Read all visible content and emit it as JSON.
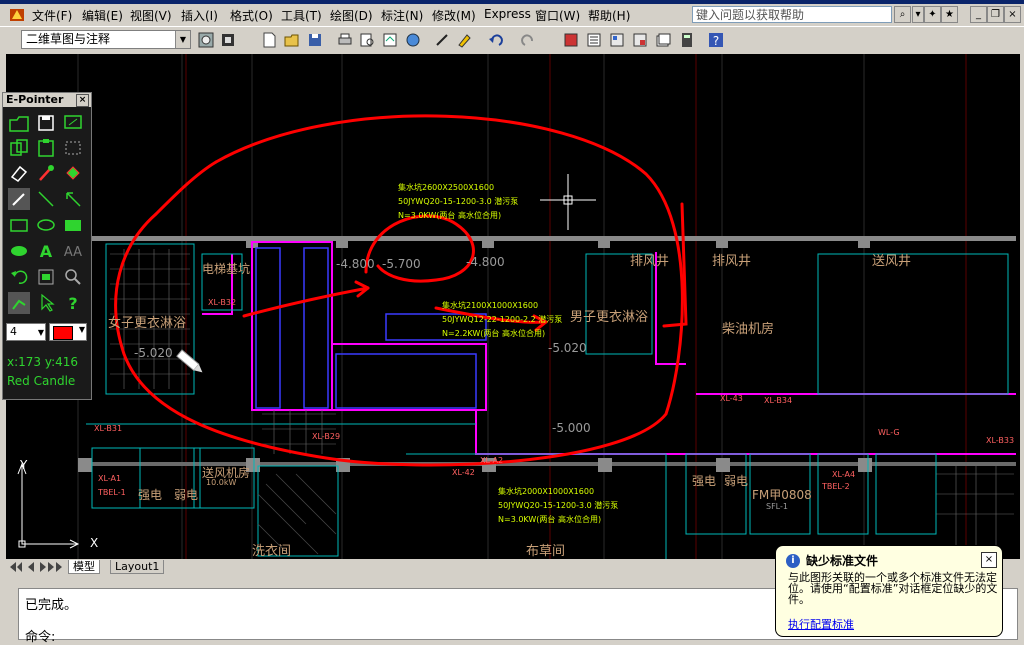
{
  "menubar": {
    "items": [
      "文件(F)",
      "编辑(E)",
      "视图(V)",
      "插入(I)",
      "格式(O)",
      "工具(T)",
      "绘图(D)",
      "标注(N)",
      "修改(M)",
      "Express",
      "窗口(W)",
      "帮助(H)"
    ],
    "search_placeholder": "键入问题以获取帮助"
  },
  "toolbar": {
    "workspace": "二维草图与注释"
  },
  "canvas": {
    "rooms": [
      "电梯基坑",
      "女子更衣淋浴",
      "排风井",
      "排风井",
      "送风井",
      "男子更衣淋浴",
      "柴油机房",
      "送风机房",
      "洗衣间",
      "布草间",
      "强电",
      "弱电",
      "强电",
      "弱电",
      "FM甲0808"
    ],
    "levels": [
      "-4.800",
      "-5.700",
      "-4.800",
      "-5.020",
      "-5.020",
      "-5.000"
    ],
    "notes": [
      "集水坑2600X2500X1600",
      "50JYWQ20-15-1200-3.0 潜污泵",
      "N=3.0KW(两台 高水位合用)",
      "集水坑2100X1000X1600",
      "50JYWQ12-22-1200-2.2 潜污泵",
      "N=2.2KW(两台 高水位合用)",
      "集水坑2000X1000X1600",
      "50JYWQ20-15-1200-3.0 潜污泵",
      "N=3.0KW(两台 高水位合用)"
    ],
    "tags": [
      "XL-B32",
      "XL-B31",
      "XL-B29",
      "XL-A1",
      "TBEL-1",
      "XL-A2",
      "XL-42",
      "XL-43",
      "XL-B34",
      "WL-G",
      "XL-B33",
      "XL-A4",
      "TBEL-2",
      "SFL-1",
      "10.0kW"
    ],
    "axis_y": "Y",
    "axis_x": "X"
  },
  "epointer": {
    "title": "E-Pointer",
    "size": "4",
    "coords": "x:173  y:416",
    "pen_name": "Red Candle",
    "pen_color": "#ff0000"
  },
  "tabs": [
    "模型",
    "Layout1"
  ],
  "command": {
    "line1": "已完成。",
    "line2": "命令:"
  },
  "notification": {
    "title": "缺少标准文件",
    "body": "与此图形关联的一个或多个标准文件无法定位。请使用“配置标准”对话框定位缺少的文件。",
    "link": "执行配置标准"
  },
  "colors": {
    "annotation_red": "#ff0000",
    "wall_magenta": "#ff00ff",
    "grid_gray": "#7a7a7a",
    "room_text": "#c8a078",
    "note_green": "#d8ff00",
    "note_blue": "#4f6dff"
  }
}
